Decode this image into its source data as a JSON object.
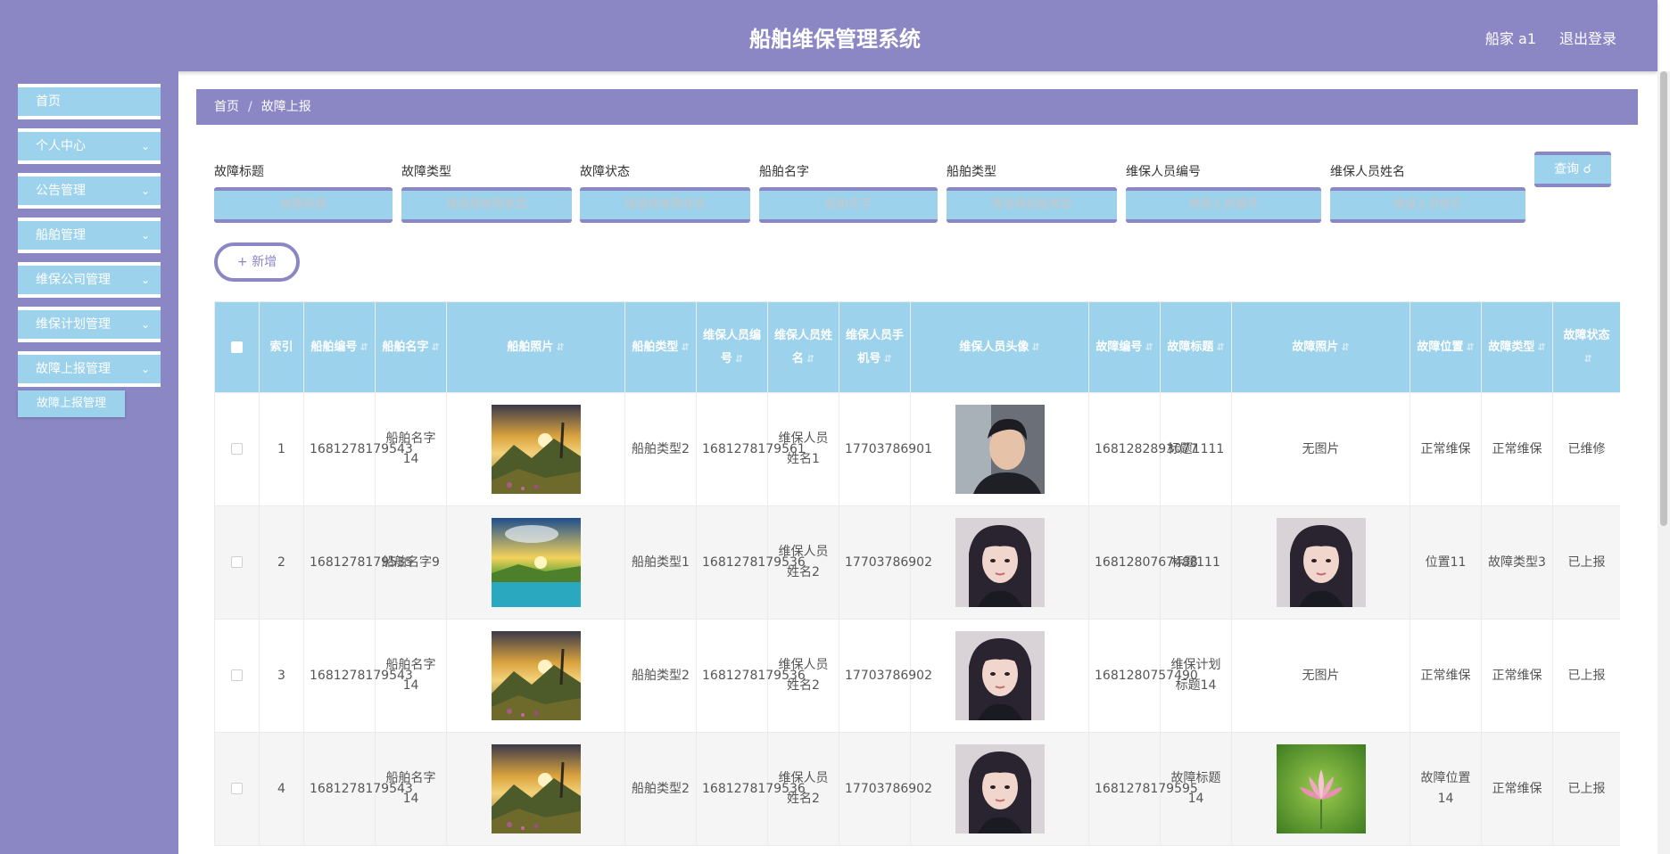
{
  "header": {
    "title": "船舶维保管理系统",
    "user": "船家 a1",
    "logout": "退出登录"
  },
  "sidebar": {
    "items": [
      {
        "label": "首页"
      },
      {
        "label": "个人中心"
      },
      {
        "label": "公告管理"
      },
      {
        "label": "船舶管理"
      },
      {
        "label": "维保公司管理"
      },
      {
        "label": "维保计划管理"
      },
      {
        "label": "故障上报管理"
      }
    ],
    "active_sub": "故障上报管理"
  },
  "breadcrumb": {
    "home": "首页",
    "current": "故障上报"
  },
  "search": {
    "fields": [
      {
        "label": "故障标题",
        "placeholder": "故障标题"
      },
      {
        "label": "故障类型",
        "placeholder": "请选择故障类型"
      },
      {
        "label": "故障状态",
        "placeholder": "请选择故障状态"
      },
      {
        "label": "船舶名字",
        "placeholder": "船舶名字"
      },
      {
        "label": "船舶类型",
        "placeholder": "请选择船舶类型"
      },
      {
        "label": "维保人员编号",
        "placeholder": "维保人员编号"
      },
      {
        "label": "维保人员姓名",
        "placeholder": "维保人员姓名"
      }
    ],
    "query": "查询"
  },
  "add": "新增",
  "table": {
    "headers": [
      "索引",
      "船舶编号",
      "船舶名字",
      "船舶照片",
      "船舶类型",
      "维保人员编号",
      "维保人员姓名",
      "维保人员手机号",
      "维保人员头像",
      "故障编号",
      "故障标题",
      "故障照片",
      "故障位置",
      "故障类型",
      "故障状态"
    ],
    "rows": [
      {
        "index": "1",
        "ship_no": "1681278179543",
        "ship_name": "船舶名字14",
        "ship_img": "landscape-sunset",
        "ship_type": "船舶类型2",
        "staff_no": "1681278179561",
        "staff_name": "维保人员姓名1",
        "staff_phone": "17703786901",
        "avatar": "male-avatar",
        "fault_no": "1681282893077",
        "fault_title": "标题1111",
        "fault_img": "",
        "fault_img_text": "无图片",
        "fault_pos": "正常维保",
        "fault_type": "正常维保",
        "fault_status": "已维修"
      },
      {
        "index": "2",
        "ship_no": "1681278179535",
        "ship_name": "船舶名字9",
        "ship_img": "landscape-lake",
        "ship_type": "船舶类型1",
        "staff_no": "1681278179536",
        "staff_name": "维保人员姓名2",
        "staff_phone": "17703786902",
        "avatar": "female-avatar",
        "fault_no": "1681280767488",
        "fault_title": "标题111",
        "fault_img": "female-avatar",
        "fault_img_text": "",
        "fault_pos": "位置11",
        "fault_type": "故障类型3",
        "fault_status": "已上报"
      },
      {
        "index": "3",
        "ship_no": "1681278179543",
        "ship_name": "船舶名字14",
        "ship_img": "landscape-sunset",
        "ship_type": "船舶类型2",
        "staff_no": "1681278179536",
        "staff_name": "维保人员姓名2",
        "staff_phone": "17703786902",
        "avatar": "female-avatar",
        "fault_no": "1681280757490",
        "fault_title": "维保计划标题14",
        "fault_img": "",
        "fault_img_text": "无图片",
        "fault_pos": "正常维保",
        "fault_type": "正常维保",
        "fault_status": "已上报"
      },
      {
        "index": "4",
        "ship_no": "1681278179543",
        "ship_name": "船舶名字14",
        "ship_img": "landscape-sunset",
        "ship_type": "船舶类型2",
        "staff_no": "1681278179536",
        "staff_name": "维保人员姓名2",
        "staff_phone": "17703786902",
        "avatar": "female-avatar",
        "fault_no": "1681278179595",
        "fault_title": "故障标题14",
        "fault_img": "lotus-flower",
        "fault_img_text": "",
        "fault_pos": "故障位置14",
        "fault_type": "正常维保",
        "fault_status": "已上报"
      }
    ]
  },
  "colors": {
    "primary": "#8a87c4",
    "accent": "#9cd2eb"
  }
}
